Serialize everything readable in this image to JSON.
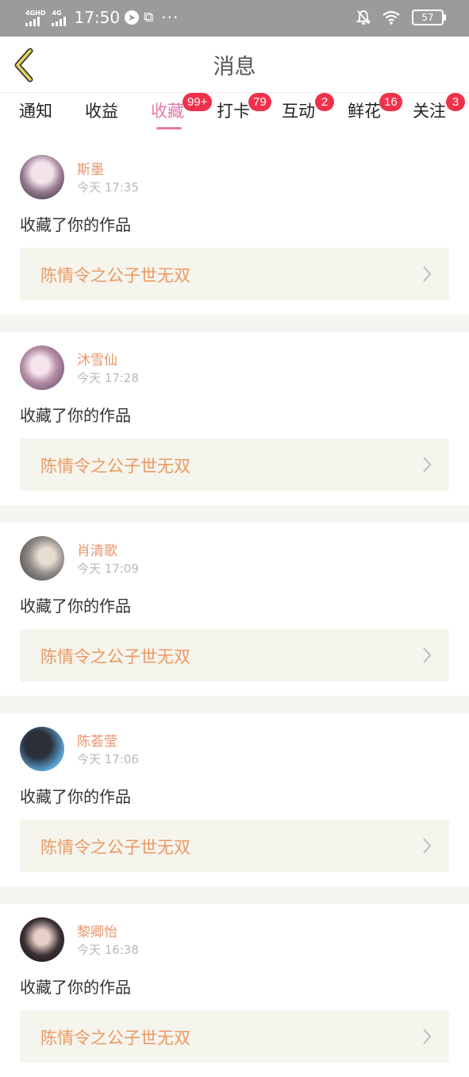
{
  "statusbar": {
    "network1_label": "4GHD",
    "network2_label": "4G",
    "time": "17:50",
    "more": "···",
    "battery": "57"
  },
  "header": {
    "title": "消息"
  },
  "tabs": [
    {
      "label": "通知",
      "badge": ""
    },
    {
      "label": "收益",
      "badge": ""
    },
    {
      "label": "收藏",
      "badge": "99+",
      "active": true
    },
    {
      "label": "打卡",
      "badge": "79"
    },
    {
      "label": "互动",
      "badge": "2"
    },
    {
      "label": "鲜花",
      "badge": "16"
    },
    {
      "label": "关注",
      "badge": "3"
    }
  ],
  "messages": [
    {
      "name": "斯墨",
      "time": "今天 17:35",
      "action": "收藏了你的作品",
      "work": "陈情令之公子世无双"
    },
    {
      "name": "沐雪仙",
      "time": "今天 17:28",
      "action": "收藏了你的作品",
      "work": "陈情令之公子世无双"
    },
    {
      "name": "肖清歌",
      "time": "今天 17:09",
      "action": "收藏了你的作品",
      "work": "陈情令之公子世无双"
    },
    {
      "name": "陈荟莹",
      "time": "今天 17:06",
      "action": "收藏了你的作品",
      "work": "陈情令之公子世无双"
    },
    {
      "name": "黎卿怡",
      "time": "今天 16:38",
      "action": "收藏了你的作品",
      "work": "陈情令之公子世无双"
    }
  ],
  "colors": {
    "accent_pink": "#e47aa7",
    "badge_red": "#f0314b",
    "name_orange": "#e8946a",
    "work_bg": "#f5f4ed"
  }
}
